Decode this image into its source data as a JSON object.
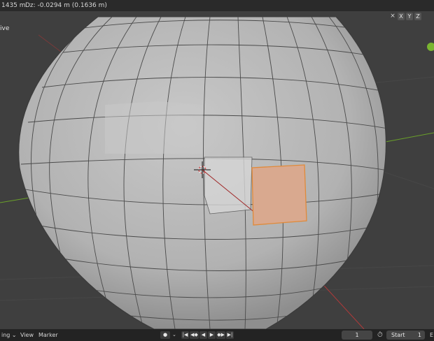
{
  "header": {
    "dx_text": "1435 m",
    "dz_text": "Dz: -0.0294 m (0.1636 m)"
  },
  "viewport": {
    "mode_label": "ive",
    "axis_buttons": [
      "X",
      "Y",
      "Z"
    ],
    "axis_icon": "mirror-axis-icon",
    "colors": {
      "mesh_face": "#b9b9b9",
      "mesh_edge": "#4a4a4a",
      "selected_face": "#d9a98f",
      "selected_edge": "#e08a3a",
      "x_axis": "#b03a3a",
      "y_axis": "#6aa02a",
      "background": "#3f3f3f"
    }
  },
  "timeline": {
    "menu_left": "ing",
    "view_label": "View",
    "marker_label": "Marker",
    "record_symbol": "●",
    "playback_symbols": [
      "|◀",
      "◀◆",
      "◀",
      "▶",
      "◆▶",
      "▶|"
    ],
    "current_frame": "1",
    "start_label": "Start",
    "start_value": "1",
    "end_label": "E"
  }
}
